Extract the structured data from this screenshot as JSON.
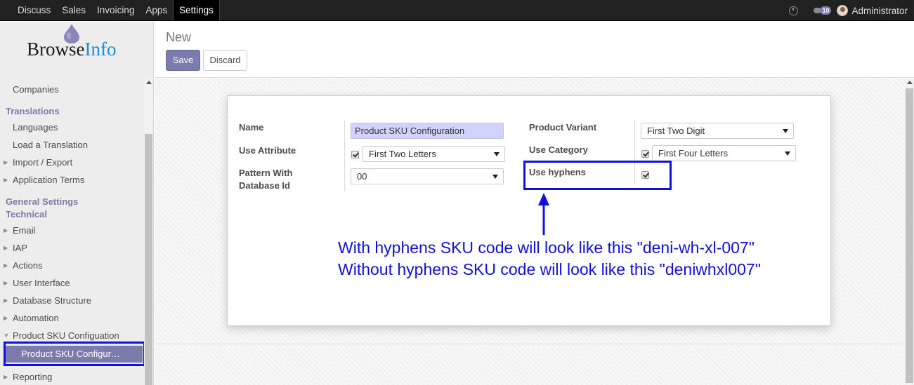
{
  "topbar": {
    "menu": [
      "Discuss",
      "Sales",
      "Invoicing",
      "Apps",
      "Settings"
    ],
    "active_menu": "Settings",
    "notification_count": "10",
    "user_name": "Administrator"
  },
  "logo": {
    "part1": "Browse",
    "part2": "Info"
  },
  "sidebar": {
    "items": [
      {
        "label": "Companies"
      },
      {
        "label": "Translations"
      },
      {
        "label": "Languages"
      },
      {
        "label": "Load a Translation"
      },
      {
        "label": "Import / Export"
      },
      {
        "label": "Application Terms"
      },
      {
        "label": "General Settings"
      },
      {
        "label": "Technical"
      },
      {
        "label": "Email"
      },
      {
        "label": "IAP"
      },
      {
        "label": "Actions"
      },
      {
        "label": "User Interface"
      },
      {
        "label": "Database Structure"
      },
      {
        "label": "Automation"
      },
      {
        "label": "Product SKU Configuation"
      },
      {
        "label": "Product SKU Configur…"
      },
      {
        "label": "Reporting"
      }
    ]
  },
  "control_panel": {
    "title": "New",
    "save_label": "Save",
    "discard_label": "Discard"
  },
  "form": {
    "name_label": "Name",
    "name_value": "Product SKU Configuration",
    "use_attribute_label": "Use Attribute",
    "use_attribute_checked": true,
    "attribute_select": "First Two Letters",
    "pattern_label_line1": "Pattern With",
    "pattern_label_line2": "Database Id",
    "pattern_select": "00",
    "product_variant_label": "Product Variant",
    "product_variant_select": "First Two Digit",
    "use_category_label": "Use Category",
    "use_category_checked": true,
    "category_select": "First Four Letters",
    "use_hyphens_label": "Use hyphens",
    "use_hyphens_checked": true
  },
  "annotation": {
    "line1": "With hyphens SKU code will look like this \"deni-wh-xl-007\"",
    "line2": "Without hyphens SKU code will look like this \"deniwhxl007\"",
    "color": "#1010e0"
  },
  "colors": {
    "accent": "#7c7bad",
    "topbar": "#212121",
    "highlight": "#1010e0"
  }
}
